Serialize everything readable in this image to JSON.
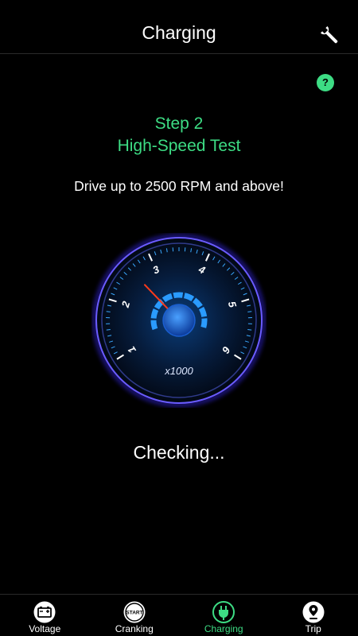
{
  "header": {
    "title": "Charging"
  },
  "help": {
    "label": "?"
  },
  "step": {
    "number": "Step 2",
    "name": "High-Speed Test"
  },
  "instruction": "Drive up to 2500 RPM and above!",
  "gauge": {
    "tick_labels": [
      "1",
      "2",
      "3",
      "4",
      "5",
      "6"
    ],
    "unit": "x1000",
    "needle_value": 2.6
  },
  "status": "Checking...",
  "tabs": [
    {
      "label": "Voltage",
      "icon": "battery-icon"
    },
    {
      "label": "Cranking",
      "icon": "start-icon",
      "icon_text": "START"
    },
    {
      "label": "Charging",
      "icon": "plug-icon"
    },
    {
      "label": "Trip",
      "icon": "map-pin-icon"
    }
  ],
  "colors": {
    "accent": "#3ddc84",
    "gauge_blue": "#2a7fff",
    "needle": "#ff3a1a"
  }
}
